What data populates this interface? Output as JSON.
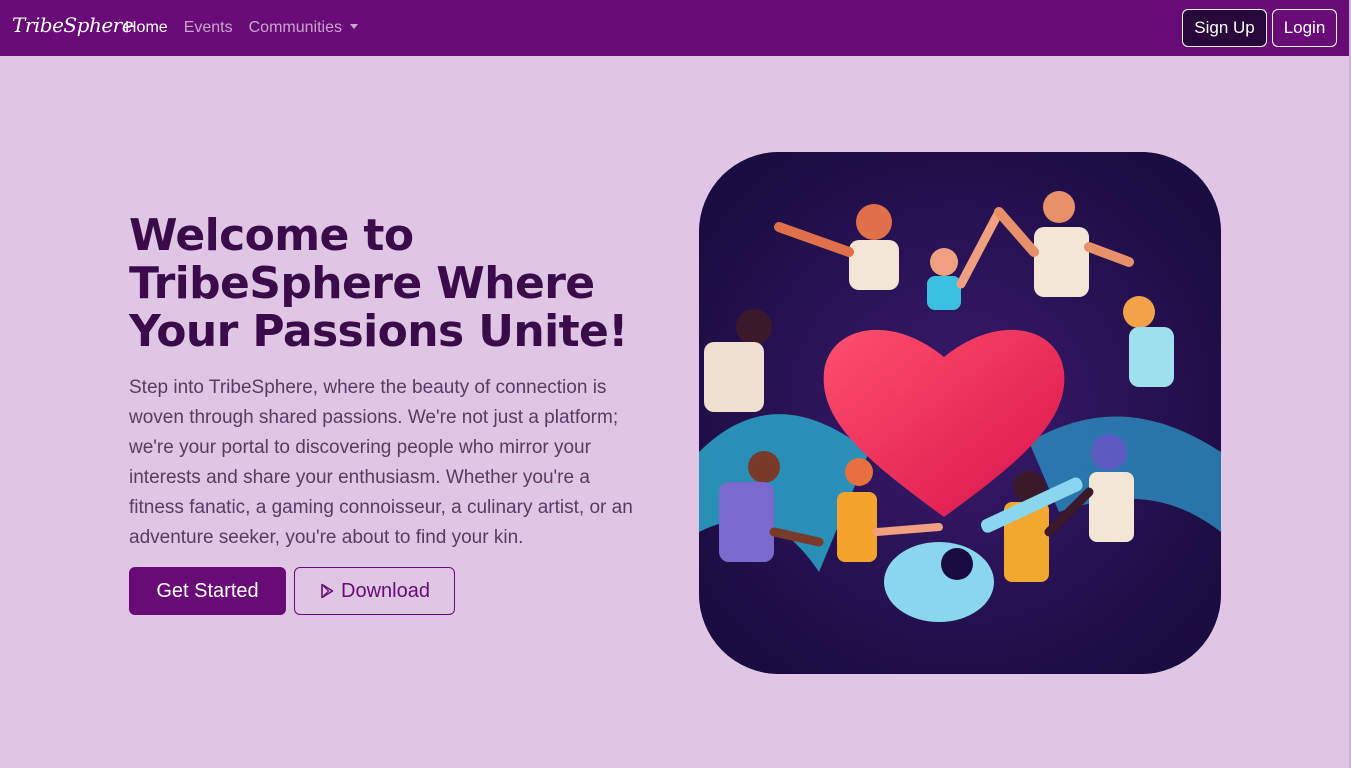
{
  "navbar": {
    "brand": "TribeSphere",
    "links": [
      {
        "label": "Home"
      },
      {
        "label": "Events"
      },
      {
        "label": "Communities"
      }
    ],
    "signup_label": "Sign Up",
    "login_label": "Login"
  },
  "hero": {
    "title": "Welcome to TribeSphere Where Your Passions Unite!",
    "description": "Step into TribeSphere, where the beauty of connection is woven through shared passions. We're not just a platform; we're your portal to discovering people who mirror your interests and share your enthusiasm. Whether you're a fitness fanatic, a gaming connoisseur, a culinary artist, or an adventure seeker, you're about to find your kin.",
    "get_started_label": "Get Started",
    "download_label": "Download",
    "download_icon": "play-store-icon",
    "image_icon": "community-illustration"
  },
  "colors": {
    "navbar_bg": "#680b77",
    "page_bg": "#e0c6e5",
    "title_text": "#3a0a4a",
    "accent": "#680b77"
  }
}
